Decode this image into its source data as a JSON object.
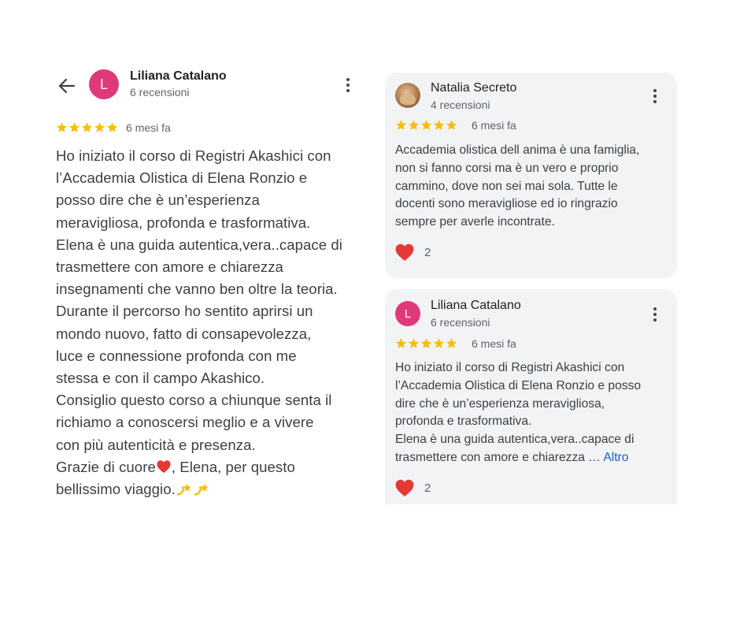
{
  "detail": {
    "author_initial": "L",
    "author_name": "Liliana Catalano",
    "review_count": "6 recensioni",
    "rating": 5,
    "time_ago": "6 mesi fa",
    "body_lines": [
      "Ho iniziato il corso di Registri Akashici con",
      "l’Accademia Olistica di Elena Ronzio e",
      "posso dire che è un’esperienza",
      "meravigliosa, profonda e trasformativa.",
      "Elena è una guida autentica,vera..capace di",
      "trasmettere con amore e chiarezza",
      "insegnamenti che vanno ben oltre la teoria.",
      "Durante il percorso ho sentito aprirsi un",
      "mondo nuovo, fatto di consapevolezza,",
      "luce e connessione profonda con me",
      "stessa e con il campo Akashico.",
      "Consiglio questo corso a chiunque senta il",
      "richiamo a conoscersi meglio e a vivere",
      "con più autenticità e presenza."
    ],
    "closing_before_heart": "Grazie di cuore",
    "closing_after_heart": ", Elena, per questo",
    "closing_last": "bellissimo viaggio.",
    "emoji_heart": "red-heart-emoji",
    "emoji_end": "dizzy-emoji"
  },
  "cards": [
    {
      "author_name": "Natalia Secreto",
      "review_count": "4 recensioni",
      "avatar": "profile-photo",
      "rating": 5,
      "time_ago": "6 mesi fa",
      "body_lines": [
        "Accademia olistica dell anima è una famiglia,",
        "non si fanno corsi ma è un vero e proprio",
        "cammino, dove non sei mai sola. Tutte le",
        "docenti sono meravigliose ed io ringrazio",
        "sempre per averle incontrate."
      ],
      "reaction_count": "2"
    },
    {
      "author_initial": "L",
      "author_name": "Liliana Catalano",
      "review_count": "6 recensioni",
      "rating": 5,
      "time_ago": "6 mesi fa",
      "body_lines": [
        "Ho iniziato il corso di Registri Akashici con",
        "l’Accademia Olistica di Elena Ronzio e posso",
        "dire che è un’esperienza meravigliosa,",
        "profonda e trasformativa.",
        "Elena è una guida autentica,vera..capace di"
      ],
      "last_line": "trasmettere con amore e chiarezza … ",
      "more_label": "Altro",
      "reaction_count": "2"
    }
  ],
  "colors": {
    "avatar_pink": "#e0397a",
    "star_yellow": "#fbbc04",
    "heart_red": "#e53935",
    "link_blue": "#1a5cc8",
    "card_bg": "#f2f3f5"
  }
}
